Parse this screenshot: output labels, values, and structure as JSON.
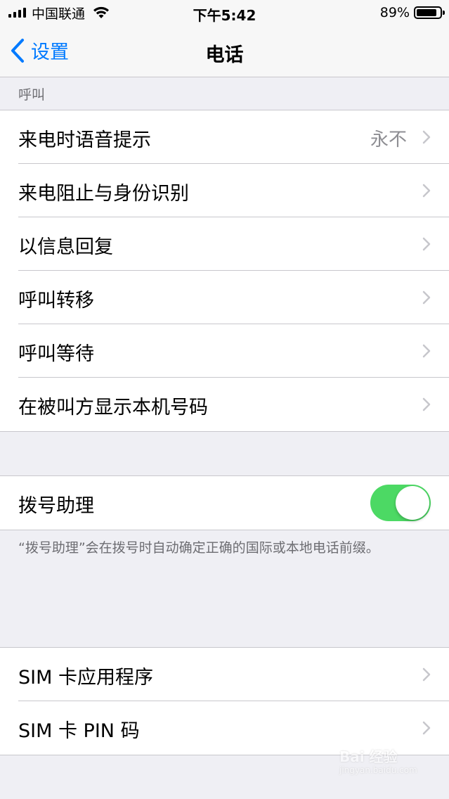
{
  "status_bar": {
    "carrier": "中国联通",
    "time": "下午5:42",
    "battery_percent_text": "89%",
    "battery_level": 0.89
  },
  "nav": {
    "back_label": "设置",
    "title": "电话"
  },
  "sections": {
    "calls_header": "呼叫",
    "calls_rows": [
      {
        "label": "来电时语音提示",
        "value": "永不"
      },
      {
        "label": "来电阻止与身份识别"
      },
      {
        "label": "以信息回复"
      },
      {
        "label": "呼叫转移"
      },
      {
        "label": "呼叫等待"
      },
      {
        "label": "在被叫方显示本机号码"
      }
    ],
    "dial_assist": {
      "label": "拨号助理",
      "enabled": true,
      "footer": "“拨号助理”会在拨号时自动确定正确的国际或本地电话前缀。"
    },
    "sim_rows": [
      {
        "label": "SIM 卡应用程序"
      },
      {
        "label": "SIM 卡 PIN 码"
      }
    ]
  },
  "watermark": {
    "brand": "Bai 经验",
    "url": "jingyan.baidu.com"
  },
  "colors": {
    "accent": "#007aff",
    "toggle_on": "#4cd964",
    "background": "#efeff4"
  }
}
